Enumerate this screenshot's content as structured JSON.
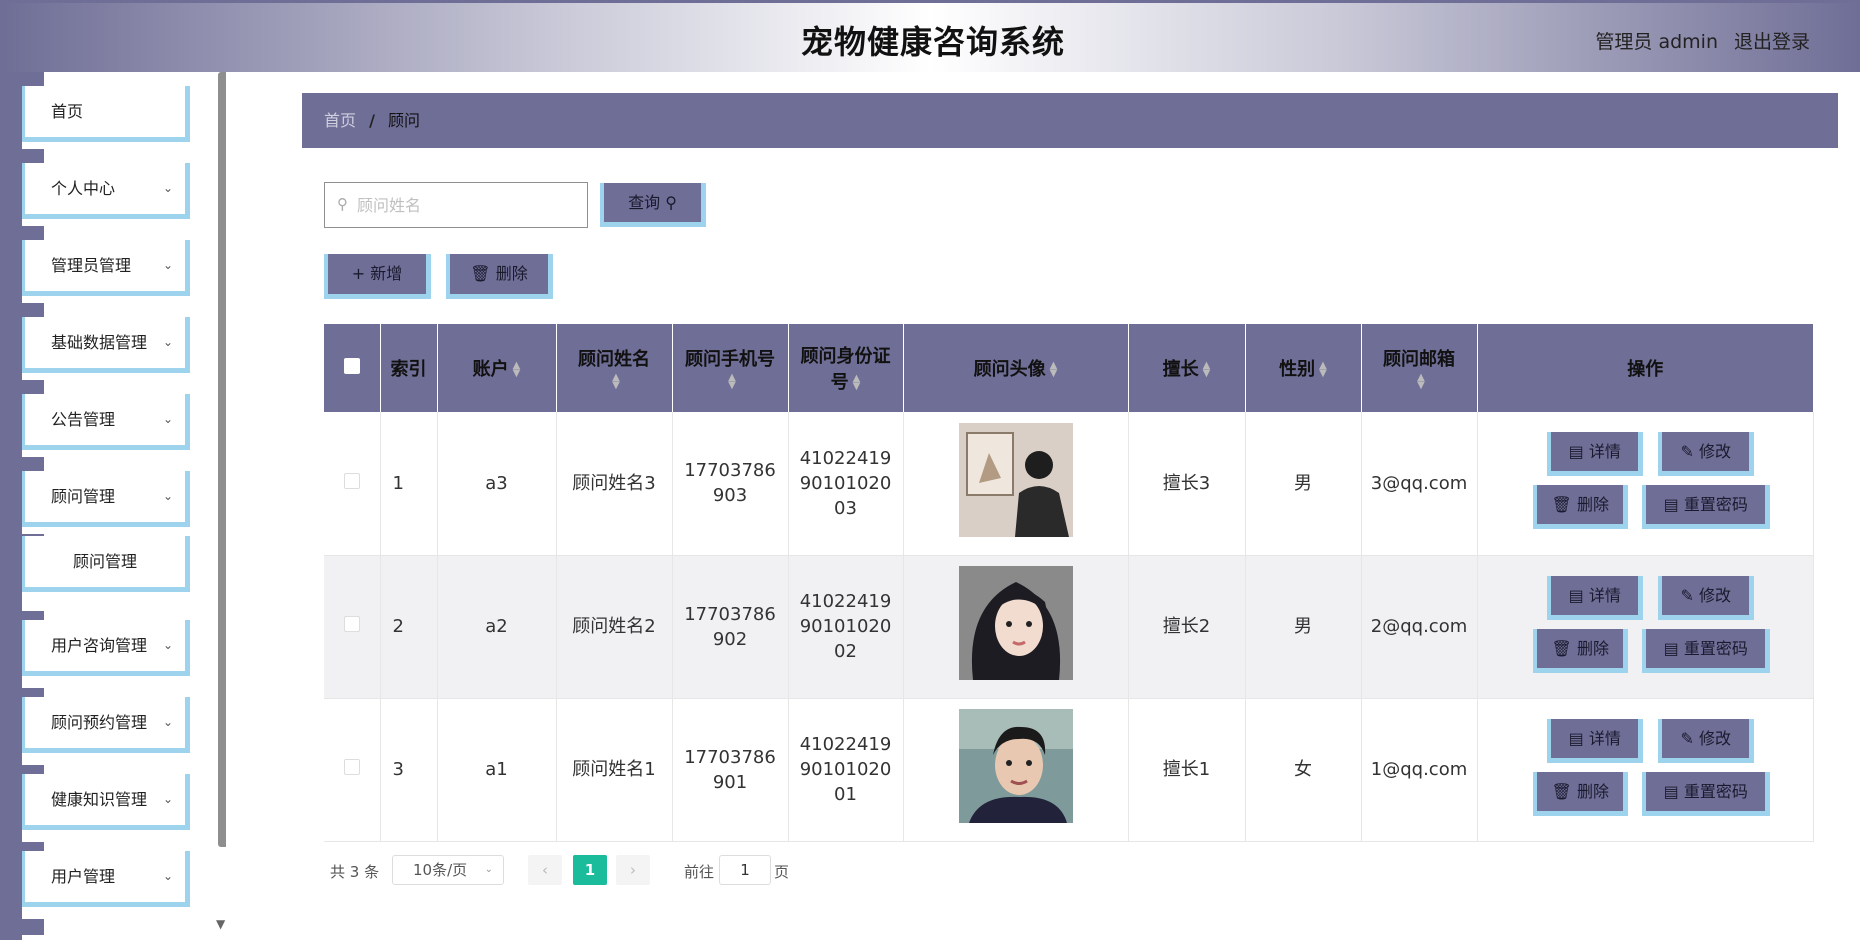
{
  "header": {
    "title": "宠物健康咨询系统",
    "user": "管理员 admin",
    "logout": "退出登录"
  },
  "sidebar": {
    "items": [
      {
        "label": "首页",
        "has_children": false
      },
      {
        "label": "个人中心",
        "has_children": true
      },
      {
        "label": "管理员管理",
        "has_children": true
      },
      {
        "label": "基础数据管理",
        "has_children": true
      },
      {
        "label": "公告管理",
        "has_children": true
      },
      {
        "label": "顾问管理",
        "has_children": true
      },
      {
        "label": "顾问管理",
        "has_children": false,
        "sub": true
      },
      {
        "label": "用户咨询管理",
        "has_children": true
      },
      {
        "label": "顾问预约管理",
        "has_children": true
      },
      {
        "label": "健康知识管理",
        "has_children": true
      },
      {
        "label": "用户管理",
        "has_children": true
      }
    ]
  },
  "breadcrumb": {
    "home": "首页",
    "separator": "/",
    "current": "顾问"
  },
  "search": {
    "placeholder": "顾问姓名",
    "value": "",
    "button": "查询"
  },
  "toolbar": {
    "add": "新增",
    "delete": "删除"
  },
  "table": {
    "headers": [
      "索引",
      "账户",
      "顾问姓名",
      "顾问手机号",
      "顾问身份证号",
      "顾问头像",
      "擅长",
      "性别",
      "顾问邮箱",
      "操作"
    ],
    "rows": [
      {
        "index": "1",
        "account": "a3",
        "name": "顾问姓名3",
        "phone": "17703786903",
        "id_card": "410224199010102003",
        "skill": "擅长3",
        "gender": "男",
        "email": "3@qq.com",
        "avatar": "photo-back-view"
      },
      {
        "index": "2",
        "account": "a2",
        "name": "顾问姓名2",
        "phone": "17703786902",
        "id_card": "410224199010102002",
        "skill": "擅长2",
        "gender": "男",
        "email": "2@qq.com",
        "avatar": "photo-girl-portrait"
      },
      {
        "index": "3",
        "account": "a1",
        "name": "顾问姓名1",
        "phone": "17703786901",
        "id_card": "410224199010102001",
        "skill": "擅长1",
        "gender": "女",
        "email": "1@qq.com",
        "avatar": "photo-man-portrait"
      }
    ],
    "actions": {
      "detail": "详情",
      "edit": "修改",
      "delete": "删除",
      "reset": "重置密码"
    }
  },
  "pagination": {
    "total": "共 3 条",
    "page_size": "10条/页",
    "current_page": "1",
    "goto_label": "前往",
    "goto_value": "1",
    "page_unit": "页"
  },
  "colors": {
    "accent": "#6f6e96",
    "border_accent": "#9ed3ee",
    "pager_active": "#1abc9c"
  }
}
